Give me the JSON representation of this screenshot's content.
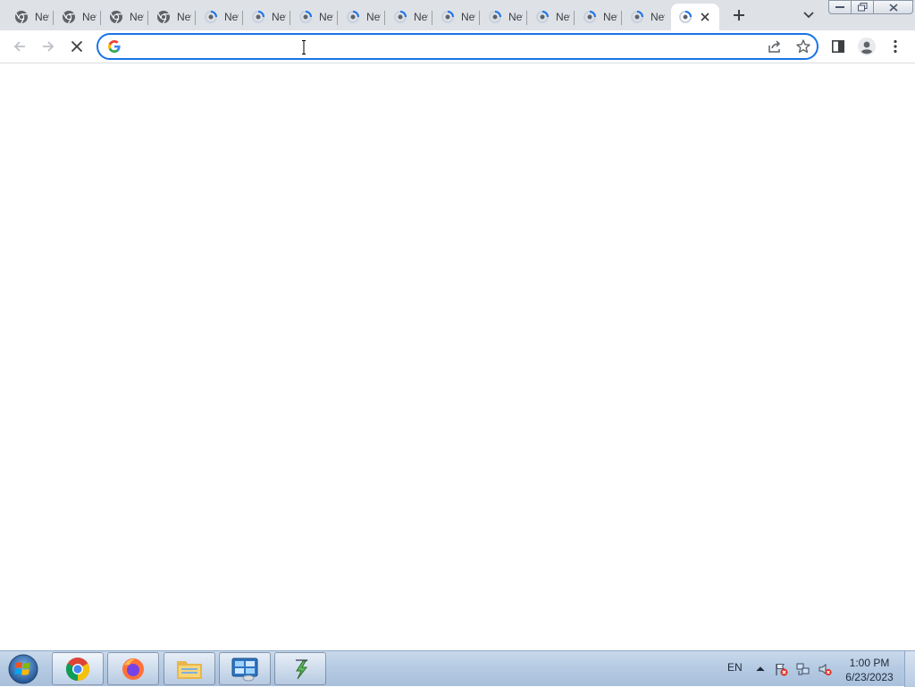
{
  "browser": {
    "tabs": [
      {
        "title": "New Tab",
        "icon": "chrome-icon"
      },
      {
        "title": "New Tab",
        "icon": "chrome-icon"
      },
      {
        "title": "New Tab",
        "icon": "chrome-icon"
      },
      {
        "title": "New Tab",
        "icon": "chrome-icon"
      },
      {
        "title": "New Tab",
        "icon": "loading-spinner-icon"
      },
      {
        "title": "New Tab",
        "icon": "loading-spinner-icon"
      },
      {
        "title": "New Tab",
        "icon": "loading-spinner-icon"
      },
      {
        "title": "New Tab",
        "icon": "loading-spinner-icon"
      },
      {
        "title": "New Tab",
        "icon": "loading-spinner-icon"
      },
      {
        "title": "New Tab",
        "icon": "loading-spinner-icon"
      },
      {
        "title": "New Tab",
        "icon": "loading-spinner-icon"
      },
      {
        "title": "New Tab",
        "icon": "loading-spinner-icon"
      },
      {
        "title": "New Tab",
        "icon": "loading-spinner-icon"
      },
      {
        "title": "New Tab",
        "icon": "loading-spinner-icon"
      },
      {
        "title": "",
        "icon": "loading-spinner-icon",
        "active": true
      }
    ],
    "omnibox": {
      "value": "",
      "placeholder": ""
    },
    "accent": "#1a73e8"
  },
  "taskbar": {
    "apps": [
      {
        "name": "Google Chrome",
        "icon": "chrome-icon"
      },
      {
        "name": "Firefox",
        "icon": "firefox-icon"
      },
      {
        "name": "File Explorer",
        "icon": "folder-icon"
      },
      {
        "name": "Control Panel",
        "icon": "control-panel-icon"
      },
      {
        "name": "Power Shortcut",
        "icon": "lightning-icon"
      }
    ],
    "language": "EN",
    "clock": {
      "time": "1:00 PM",
      "date": "6/23/2023"
    }
  }
}
